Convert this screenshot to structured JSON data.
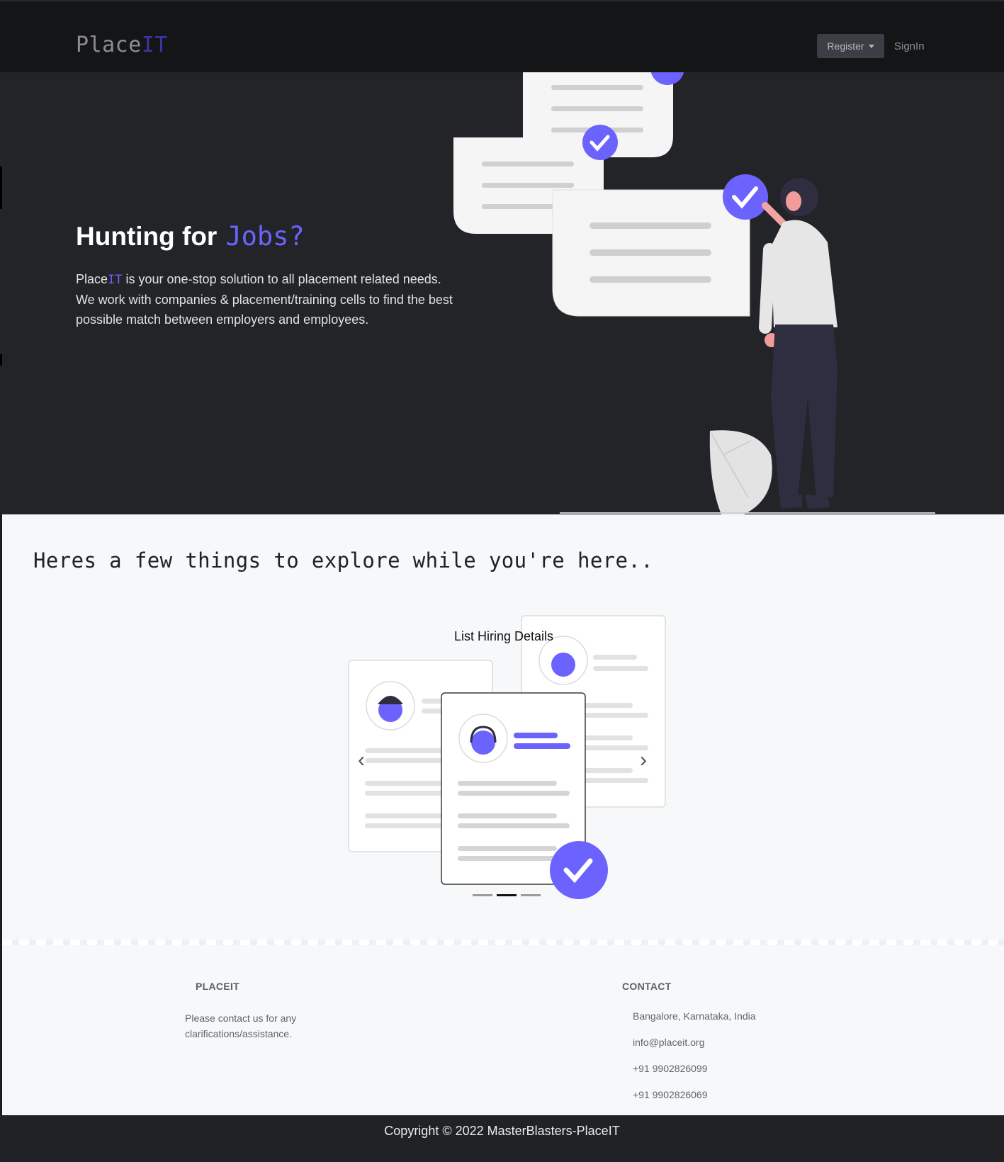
{
  "navbar": {
    "brand_main": "Place",
    "brand_accent": "IT",
    "register_label": "Register",
    "signin_label": "SignIn"
  },
  "hero": {
    "title_main": "Hunting for",
    "title_accent": "Jobs?",
    "text_brand_main": "Place",
    "text_brand_accent": "IT",
    "text_rest": " is your one-stop solution to all placement related needs. We work with companies & placement/training cells to find the best possible match between employers and employees."
  },
  "explore": {
    "heading": "Heres a few things to explore while you're here..",
    "carousel_caption": "List Hiring Details",
    "slides_total": 3,
    "active_slide": 2
  },
  "footer": {
    "placeit_title": "PLACEIT",
    "placeit_text": "Please contact us for any clarifications/assistance.",
    "contact_title": "CONTACT",
    "address": "Bangalore, Karnataka, India",
    "email": "info@placeit.org",
    "phone1": "+91 9902826099",
    "phone2": "+91 9902826069",
    "copyright": "Copyright © 2022 MasterBlasters-PlaceIT"
  },
  "colors": {
    "accent": "#6c63ff",
    "navbar_bg": "#141517",
    "hero_bg": "#222428",
    "section_bg": "#f7f8fa"
  }
}
